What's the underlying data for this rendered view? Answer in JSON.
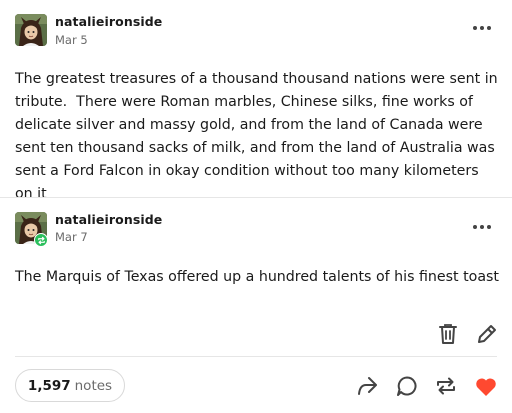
{
  "posts": [
    {
      "username": "natalieironside",
      "date": "Mar 5",
      "body": "The greatest treasures of a thousand thousand nations were sent in tribute.  There were Roman marbles, Chinese silks, fine works of delicate silver and massy gold, and from the land of Canada were sent ten thousand sacks of milk, and from the land of Australia was sent a Ford Falcon in okay condition without too many kilometers on it",
      "avatar_icon": "avatar-icon",
      "more_icon": "more-options-icon"
    },
    {
      "username": "natalieironside",
      "date": "Mar 7",
      "body": "The Marquis of Texas offered up a hundred talents of his finest toast",
      "avatar_icon": "avatar-icon",
      "badge_icon": "reblog-badge-icon",
      "more_icon": "more-options-icon"
    }
  ],
  "edit_tools": {
    "delete_icon": "trash-icon",
    "edit_icon": "pencil-icon"
  },
  "footer": {
    "notes_count": "1,597",
    "notes_label": "notes",
    "actions": [
      "share-icon",
      "reply-icon",
      "reblog-icon",
      "like-icon"
    ]
  },
  "colors": {
    "like": "#ff4930",
    "reblog_badge": "#2bbf5c",
    "avatar_bg": "#5b6f47",
    "divider": "#e6e6e6"
  }
}
